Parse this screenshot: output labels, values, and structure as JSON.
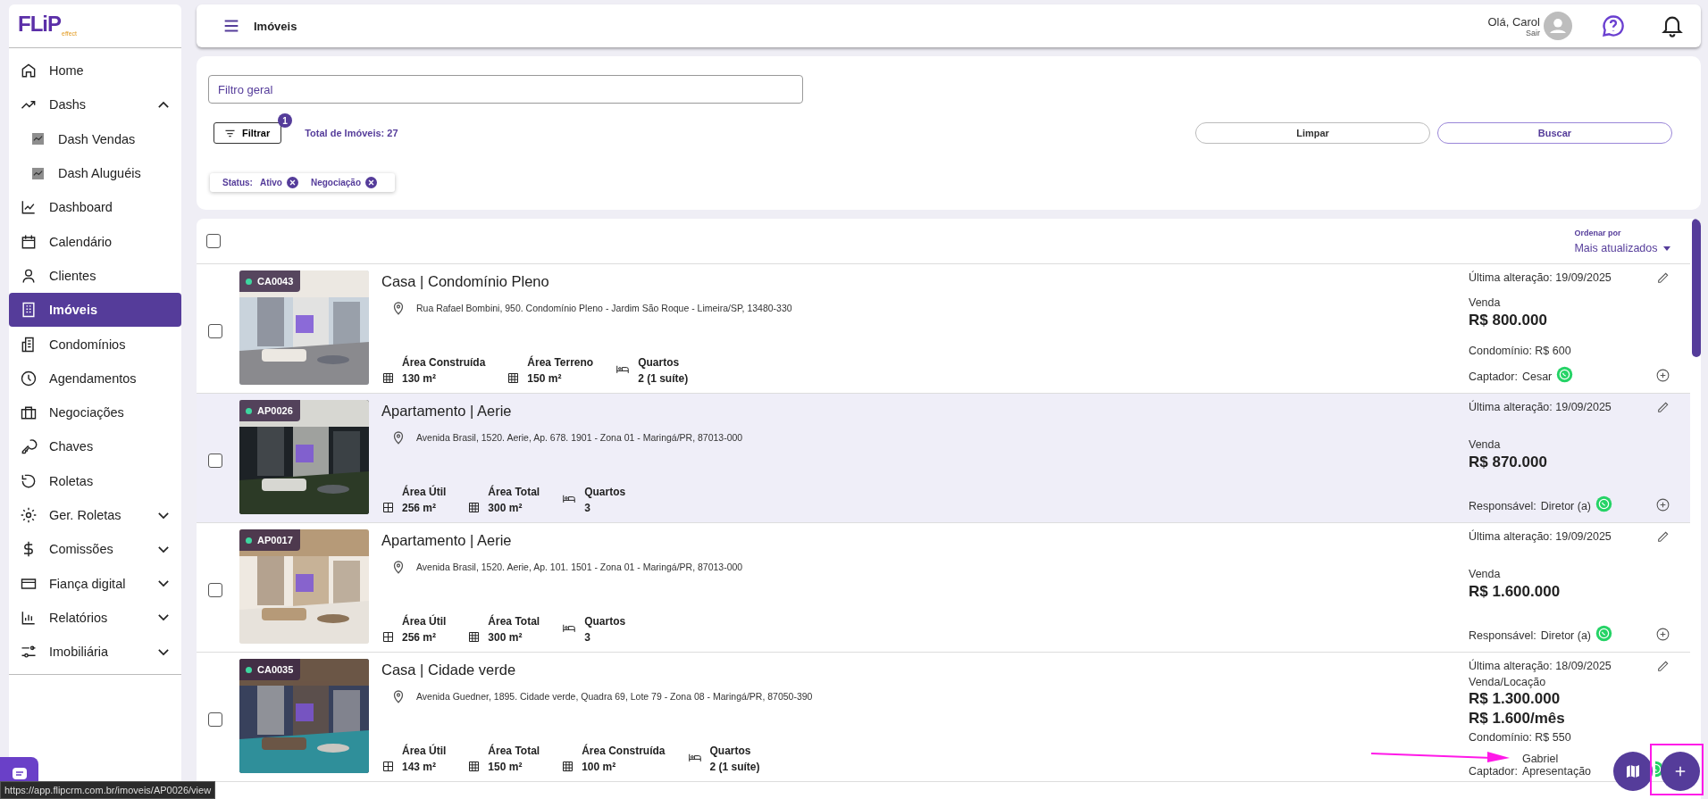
{
  "brand": {
    "logo": "FLiP",
    "tagline": "effect"
  },
  "sidebar": {
    "items": [
      {
        "label": "Home",
        "selected": false
      },
      {
        "label": "Dashs",
        "selected": false,
        "expanded": true,
        "children": [
          {
            "label": "Dash Vendas",
            "selected": false
          },
          {
            "label": "Dash Aluguéis",
            "selected": false
          }
        ]
      },
      {
        "label": "Dashboard",
        "selected": false
      },
      {
        "label": "Calendário",
        "selected": false
      },
      {
        "label": "Clientes",
        "selected": false
      },
      {
        "label": "Imóveis",
        "selected": true
      },
      {
        "label": "Condomínios",
        "selected": false
      },
      {
        "label": "Agendamentos",
        "selected": false
      },
      {
        "label": "Negociações",
        "selected": false
      },
      {
        "label": "Chaves",
        "selected": false
      },
      {
        "label": "Roletas",
        "selected": false
      },
      {
        "label": "Ger. Roletas",
        "selected": false,
        "expanded": false
      },
      {
        "label": "Comissões",
        "selected": false,
        "expanded": false
      },
      {
        "label": "Fiança digital",
        "selected": false,
        "expanded": false
      },
      {
        "label": "Relatórios",
        "selected": false,
        "expanded": false
      },
      {
        "label": "Imobiliária",
        "selected": false,
        "expanded": false
      }
    ]
  },
  "header": {
    "title": "Imóveis",
    "greeting": "Olá, Carol",
    "logout": "Sair"
  },
  "filters": {
    "search": {
      "placeholder": "Filtro geral"
    },
    "filter_button": "Filtrar",
    "filter_count": "1",
    "total": "Total de Imóveis: 27",
    "clear_button": "Limpar",
    "search_button": "Buscar",
    "chips": {
      "label": "Status:",
      "values": [
        "Ativo",
        "Negociação"
      ]
    }
  },
  "list": {
    "select_all": {
      "checked": false
    },
    "sort": {
      "label": "Ordenar por",
      "value": "Mais atualizados"
    },
    "rows": [
      {
        "code": "CA0043",
        "checked": false,
        "hovered": false,
        "title": "Casa | Condomínio Pleno",
        "address": "Rua Rafael Bombini, 950. Condomínio Pleno - Jardim São Roque - Limeira/SP, 13480-330",
        "features": [
          {
            "kind": "area",
            "label": "Área Construída",
            "value": "130 m²"
          },
          {
            "kind": "area",
            "label": "Área Terreno",
            "value": "150 m²"
          },
          {
            "kind": "bedrooms",
            "label": "Quartos",
            "value": "2 (1 suíte)"
          }
        ],
        "updated": "Última alteração: 19/09/2025",
        "deal": "Venda",
        "prices": [
          "R$ 800.000"
        ],
        "condo_fee": "Condomínio: R$ 600",
        "contact_role": "Captador:",
        "contact_name": "Cesar",
        "add_button": true
      },
      {
        "code": "AP0026",
        "checked": false,
        "hovered": true,
        "title": "Apartamento | Aerie",
        "address": "Avenida Brasil, 1520. Aerie, Ap. 678. 1901 - Zona 01 - Maringá/PR, 87013-000",
        "features": [
          {
            "kind": "useful",
            "label": "Área Útil",
            "value": "256 m²"
          },
          {
            "kind": "area",
            "label": "Área Total",
            "value": "300 m²"
          },
          {
            "kind": "bedrooms",
            "label": "Quartos",
            "value": "3"
          }
        ],
        "updated": "Última alteração: 19/09/2025",
        "deal": "Venda",
        "prices": [
          "R$ 870.000"
        ],
        "contact_role": "Responsável:",
        "contact_name": "Diretor (a)",
        "add_button": true
      },
      {
        "code": "AP0017",
        "checked": false,
        "hovered": false,
        "title": "Apartamento | Aerie",
        "address": "Avenida Brasil, 1520. Aerie, Ap. 101. 1501 - Zona 01 - Maringá/PR, 87013-000",
        "features": [
          {
            "kind": "useful",
            "label": "Área Útil",
            "value": "256 m²"
          },
          {
            "kind": "area",
            "label": "Área Total",
            "value": "300 m²"
          },
          {
            "kind": "bedrooms",
            "label": "Quartos",
            "value": "3"
          }
        ],
        "updated": "Última alteração: 19/09/2025",
        "deal": "Venda",
        "prices": [
          "R$ 1.600.000"
        ],
        "contact_role": "Responsável:",
        "contact_name": "Diretor (a)",
        "add_button": true
      },
      {
        "code": "CA0035",
        "checked": false,
        "hovered": false,
        "title": "Casa | Cidade verde",
        "address": "Avenida Guedner, 1895. Cidade verde, Quadra 69, Lote 79 - Zona 08 - Maringá/PR, 87050-390",
        "features": [
          {
            "kind": "useful",
            "label": "Área Útil",
            "value": "143 m²"
          },
          {
            "kind": "area",
            "label": "Área Total",
            "value": "150 m²"
          },
          {
            "kind": "area",
            "label": "Área Construída",
            "value": "100 m²"
          },
          {
            "kind": "bedrooms",
            "label": "Quartos",
            "value": "2 (1 suíte)"
          }
        ],
        "updated": "Última alteração: 18/09/2025",
        "deal": "Venda/Locação",
        "prices": [
          "R$ 1.300.000",
          "R$ 1.600/mês"
        ],
        "condo_fee": "Condomínio: R$ 550",
        "contact_role": "Captador:",
        "contact_name": "Gabriel Apresentação"
      }
    ]
  },
  "status_bar": {
    "url": "https://app.flipcrm.com.br/imoveis/AP0026/view"
  }
}
